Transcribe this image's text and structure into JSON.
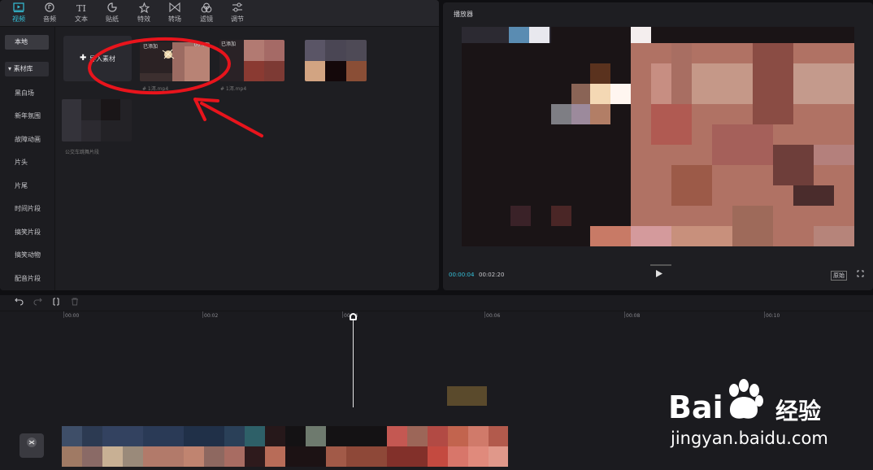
{
  "toolbar": {
    "items": [
      {
        "label": "视频",
        "icon": "video-icon",
        "active": true
      },
      {
        "label": "音频",
        "icon": "audio-icon"
      },
      {
        "label": "文本",
        "icon": "text-icon"
      },
      {
        "label": "贴纸",
        "icon": "sticker-icon"
      },
      {
        "label": "特效",
        "icon": "effects-icon"
      },
      {
        "label": "转场",
        "icon": "transition-icon"
      },
      {
        "label": "滤镜",
        "icon": "filter-icon"
      },
      {
        "label": "调节",
        "icon": "adjust-icon"
      }
    ]
  },
  "sidebar": {
    "local": "本地",
    "library": "素材库",
    "items": [
      "黑白场",
      "新年氛围",
      "故障动画",
      "片头",
      "片尾",
      "时间片段",
      "搞笑片段",
      "搞笑动物",
      "配音片段"
    ]
  },
  "media": {
    "import_label": "导入素材",
    "thumb1_tag": "已添加",
    "thumb1_duration": "00:02",
    "thumb1_name": "# 1洱.mp4",
    "thumb2_tag": "已添加",
    "thumb2_name": "# 1洱.mp4",
    "thumb4_name": "公交车跳舞片段"
  },
  "player": {
    "title": "播放器",
    "current_time": "00:00:04",
    "total_time": "00:02:20",
    "ratio_label": "原始"
  },
  "timeline": {
    "ticks": [
      "00:00",
      "00:02",
      "00:04",
      "00:06",
      "00:08",
      "00:10"
    ]
  },
  "watermark": {
    "brand_a": "Bai",
    "brand_b": "经验",
    "url": "jingyan.baidu.com"
  },
  "colors": {
    "accent": "#35c0d8",
    "annotation": "#e8141c"
  }
}
